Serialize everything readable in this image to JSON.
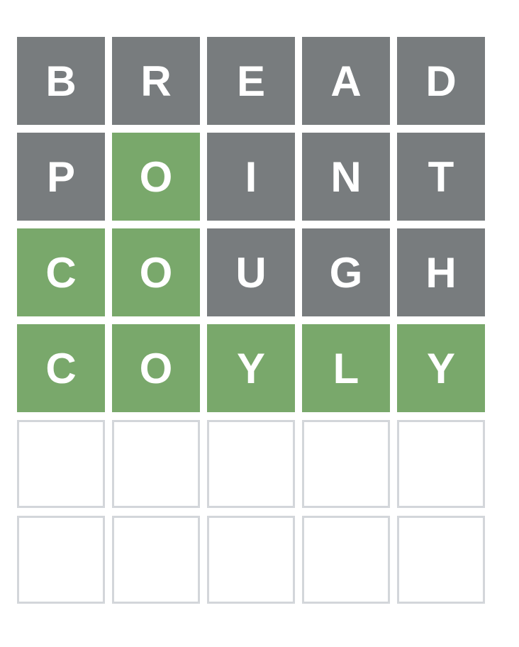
{
  "colors": {
    "absent": "#787c7e",
    "correct": "#79a86b",
    "empty_border": "#d3d6da",
    "tile_text": "#ffffff"
  },
  "board": {
    "rows": [
      {
        "letters": [
          "B",
          "R",
          "E",
          "A",
          "D"
        ],
        "states": [
          "absent",
          "absent",
          "absent",
          "absent",
          "absent"
        ]
      },
      {
        "letters": [
          "P",
          "O",
          "I",
          "N",
          "T"
        ],
        "states": [
          "absent",
          "correct",
          "absent",
          "absent",
          "absent"
        ]
      },
      {
        "letters": [
          "C",
          "O",
          "U",
          "G",
          "H"
        ],
        "states": [
          "correct",
          "correct",
          "absent",
          "absent",
          "absent"
        ]
      },
      {
        "letters": [
          "C",
          "O",
          "Y",
          "L",
          "Y"
        ],
        "states": [
          "correct",
          "correct",
          "correct",
          "correct",
          "correct"
        ]
      },
      {
        "letters": [
          "",
          "",
          "",
          "",
          ""
        ],
        "states": [
          "empty",
          "empty",
          "empty",
          "empty",
          "empty"
        ]
      },
      {
        "letters": [
          "",
          "",
          "",
          "",
          ""
        ],
        "states": [
          "empty",
          "empty",
          "empty",
          "empty",
          "empty"
        ]
      }
    ]
  }
}
